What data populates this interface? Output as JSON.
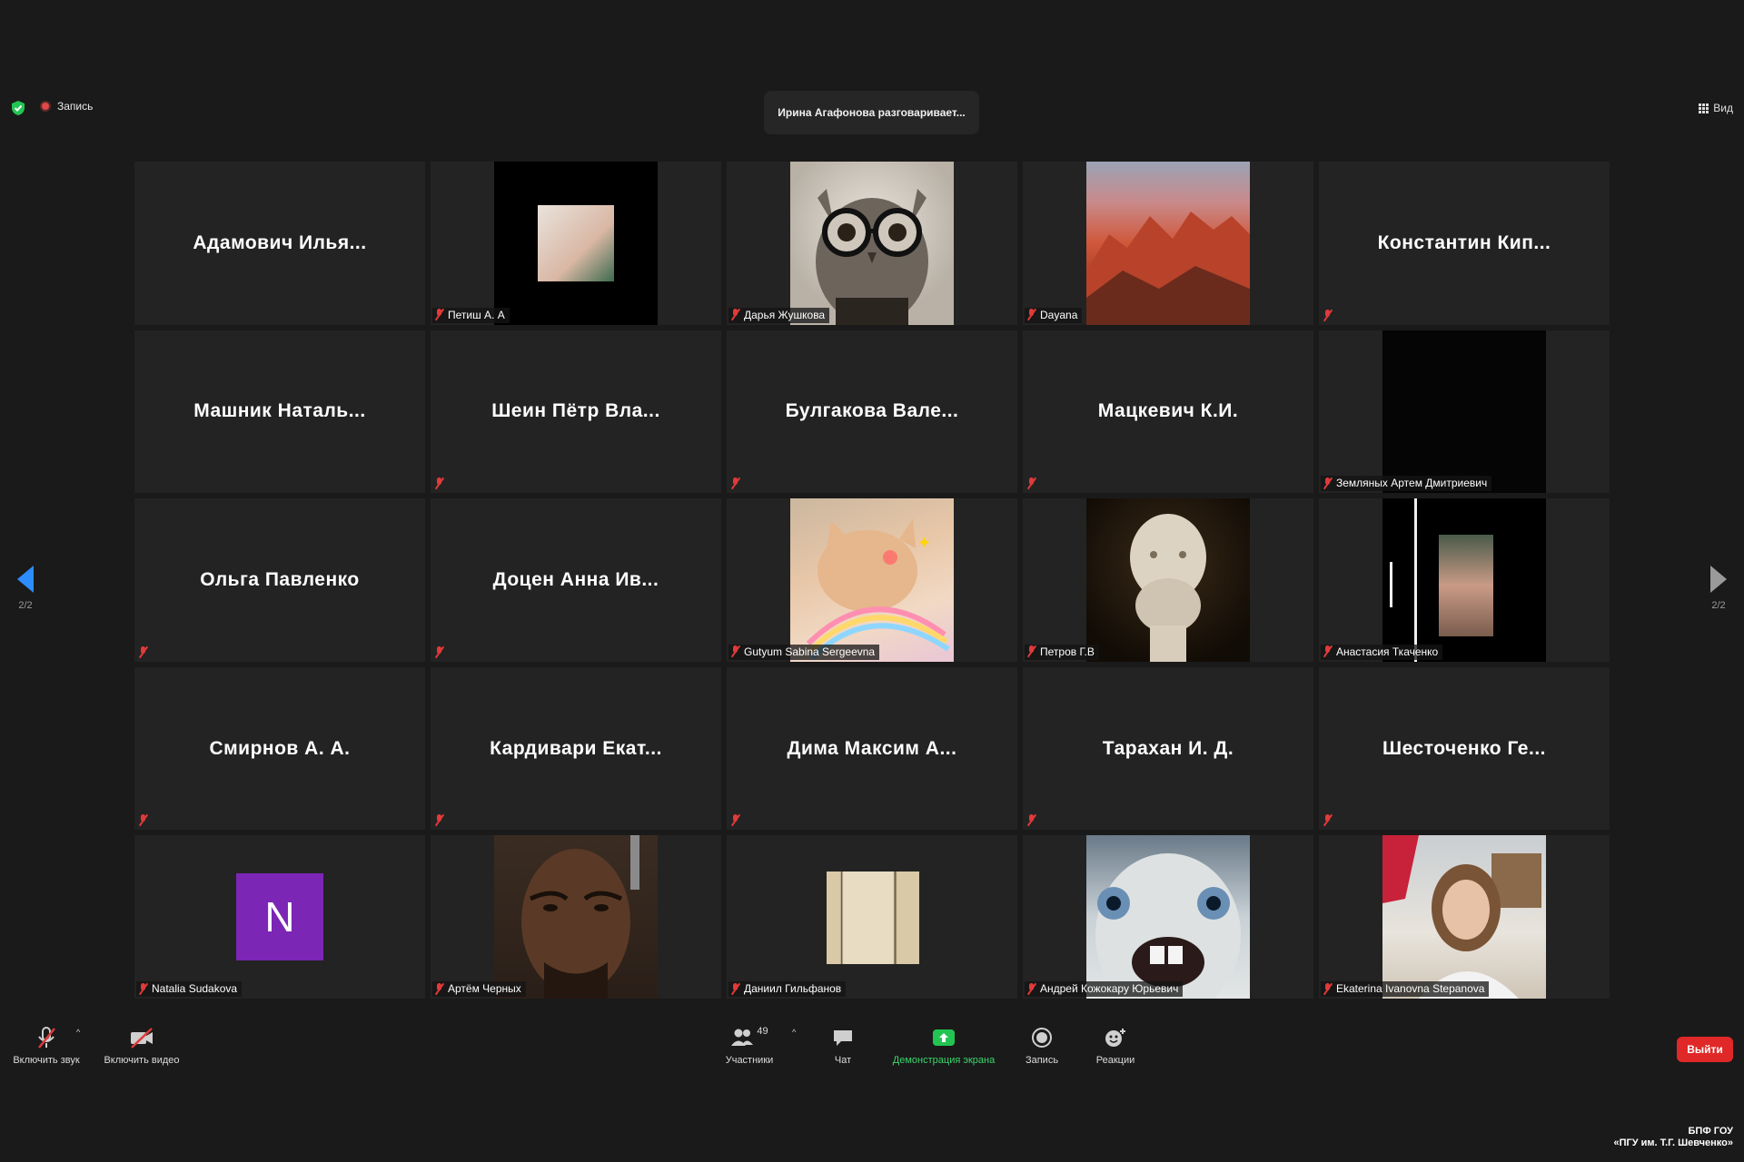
{
  "topbar": {
    "recording_label": "Запись",
    "speaker_banner": "Ирина Агафонова разговаривает...",
    "view_label": "Вид"
  },
  "nav": {
    "prev_page": "2/2",
    "next_page": "2/2"
  },
  "tiles": [
    {
      "name": "Адамович  Илья..."
    },
    {
      "label": "Петиш А. А"
    },
    {
      "label": "Дарья Жушкова"
    },
    {
      "label": "Dayana"
    },
    {
      "name": "Константин  Кип..."
    },
    {
      "name": "Машник  Наталь..."
    },
    {
      "name": "Шеин  Пётр  Вла..."
    },
    {
      "name": "Булгакова  Вале..."
    },
    {
      "name": "Мацкевич К.И."
    },
    {
      "label": "Земляных Артем Дмитриевич"
    },
    {
      "name": "Ольга Павленко"
    },
    {
      "name": "Доцен  Анна  Ив..."
    },
    {
      "label": "Gutyum Sabina Sergeevna"
    },
    {
      "label": "Петров Г.В"
    },
    {
      "label": "Анастасия Ткаченко"
    },
    {
      "name": "Смирнов А. А."
    },
    {
      "name": "Кардивари  Екат..."
    },
    {
      "name": "Дима  Максим  А..."
    },
    {
      "name": "Тарахан И. Д."
    },
    {
      "name": "Шесточенко  Ге..."
    },
    {
      "label": "Natalia Sudakova",
      "avatar_letter": "N"
    },
    {
      "label": "Артём Черных"
    },
    {
      "label": "Даниил Гильфанов"
    },
    {
      "label": "Андрей Кожокару Юрьевич"
    },
    {
      "label": "Ekaterina Ivanovna Stepanova"
    }
  ],
  "toolbar": {
    "audio_label": "Включить звук",
    "video_label": "Включить видео",
    "participants_label": "Участники",
    "participants_count": "49",
    "chat_label": "Чат",
    "share_label": "Демонстрация экрана",
    "record_label": "Запись",
    "reactions_label": "Реакции",
    "leave_label": "Выйти"
  },
  "footer": {
    "line1": "БПФ ГОУ",
    "line2": "«ПГУ им. Т.Г. Шевченко»"
  },
  "icons": {
    "security": "shield-check-icon",
    "record": "record-dot-icon",
    "view": "grid-view-icon",
    "mic_off": "microphone-off-icon",
    "camera_off": "camera-off-icon",
    "participants": "people-icon",
    "chat": "chat-bubble-icon",
    "share": "share-screen-icon",
    "reactions": "emoji-icon"
  },
  "colors": {
    "background": "#1a1a1a",
    "tile": "#232323",
    "accent_blue": "#2d8cff",
    "share_green": "#3ad56b",
    "leave_red": "#e02828",
    "avatar_purple": "#7b26b4",
    "mute_red": "#e03a3a"
  }
}
